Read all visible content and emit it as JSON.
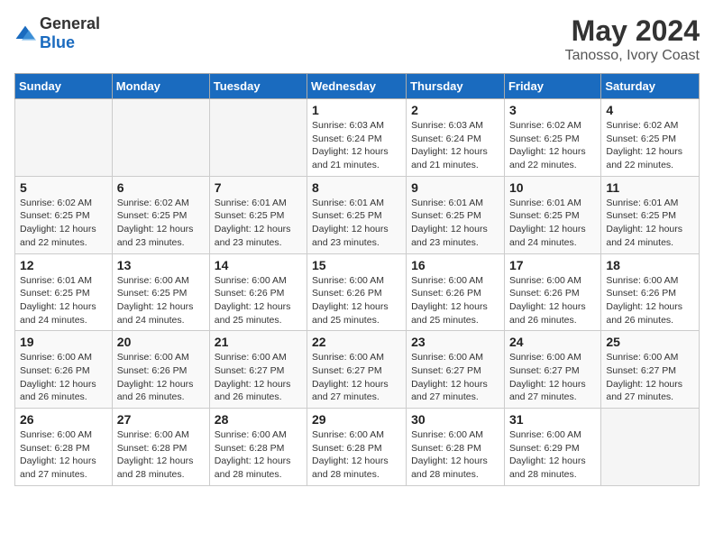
{
  "logo": {
    "general": "General",
    "blue": "Blue"
  },
  "title": "May 2024",
  "subtitle": "Tanosso, Ivory Coast",
  "days_of_week": [
    "Sunday",
    "Monday",
    "Tuesday",
    "Wednesday",
    "Thursday",
    "Friday",
    "Saturday"
  ],
  "weeks": [
    [
      {
        "day": "",
        "info": ""
      },
      {
        "day": "",
        "info": ""
      },
      {
        "day": "",
        "info": ""
      },
      {
        "day": "1",
        "info": "Sunrise: 6:03 AM\nSunset: 6:24 PM\nDaylight: 12 hours and 21 minutes."
      },
      {
        "day": "2",
        "info": "Sunrise: 6:03 AM\nSunset: 6:24 PM\nDaylight: 12 hours and 21 minutes."
      },
      {
        "day": "3",
        "info": "Sunrise: 6:02 AM\nSunset: 6:25 PM\nDaylight: 12 hours and 22 minutes."
      },
      {
        "day": "4",
        "info": "Sunrise: 6:02 AM\nSunset: 6:25 PM\nDaylight: 12 hours and 22 minutes."
      }
    ],
    [
      {
        "day": "5",
        "info": "Sunrise: 6:02 AM\nSunset: 6:25 PM\nDaylight: 12 hours and 22 minutes."
      },
      {
        "day": "6",
        "info": "Sunrise: 6:02 AM\nSunset: 6:25 PM\nDaylight: 12 hours and 23 minutes."
      },
      {
        "day": "7",
        "info": "Sunrise: 6:01 AM\nSunset: 6:25 PM\nDaylight: 12 hours and 23 minutes."
      },
      {
        "day": "8",
        "info": "Sunrise: 6:01 AM\nSunset: 6:25 PM\nDaylight: 12 hours and 23 minutes."
      },
      {
        "day": "9",
        "info": "Sunrise: 6:01 AM\nSunset: 6:25 PM\nDaylight: 12 hours and 23 minutes."
      },
      {
        "day": "10",
        "info": "Sunrise: 6:01 AM\nSunset: 6:25 PM\nDaylight: 12 hours and 24 minutes."
      },
      {
        "day": "11",
        "info": "Sunrise: 6:01 AM\nSunset: 6:25 PM\nDaylight: 12 hours and 24 minutes."
      }
    ],
    [
      {
        "day": "12",
        "info": "Sunrise: 6:01 AM\nSunset: 6:25 PM\nDaylight: 12 hours and 24 minutes."
      },
      {
        "day": "13",
        "info": "Sunrise: 6:00 AM\nSunset: 6:25 PM\nDaylight: 12 hours and 24 minutes."
      },
      {
        "day": "14",
        "info": "Sunrise: 6:00 AM\nSunset: 6:26 PM\nDaylight: 12 hours and 25 minutes."
      },
      {
        "day": "15",
        "info": "Sunrise: 6:00 AM\nSunset: 6:26 PM\nDaylight: 12 hours and 25 minutes."
      },
      {
        "day": "16",
        "info": "Sunrise: 6:00 AM\nSunset: 6:26 PM\nDaylight: 12 hours and 25 minutes."
      },
      {
        "day": "17",
        "info": "Sunrise: 6:00 AM\nSunset: 6:26 PM\nDaylight: 12 hours and 26 minutes."
      },
      {
        "day": "18",
        "info": "Sunrise: 6:00 AM\nSunset: 6:26 PM\nDaylight: 12 hours and 26 minutes."
      }
    ],
    [
      {
        "day": "19",
        "info": "Sunrise: 6:00 AM\nSunset: 6:26 PM\nDaylight: 12 hours and 26 minutes."
      },
      {
        "day": "20",
        "info": "Sunrise: 6:00 AM\nSunset: 6:26 PM\nDaylight: 12 hours and 26 minutes."
      },
      {
        "day": "21",
        "info": "Sunrise: 6:00 AM\nSunset: 6:27 PM\nDaylight: 12 hours and 26 minutes."
      },
      {
        "day": "22",
        "info": "Sunrise: 6:00 AM\nSunset: 6:27 PM\nDaylight: 12 hours and 27 minutes."
      },
      {
        "day": "23",
        "info": "Sunrise: 6:00 AM\nSunset: 6:27 PM\nDaylight: 12 hours and 27 minutes."
      },
      {
        "day": "24",
        "info": "Sunrise: 6:00 AM\nSunset: 6:27 PM\nDaylight: 12 hours and 27 minutes."
      },
      {
        "day": "25",
        "info": "Sunrise: 6:00 AM\nSunset: 6:27 PM\nDaylight: 12 hours and 27 minutes."
      }
    ],
    [
      {
        "day": "26",
        "info": "Sunrise: 6:00 AM\nSunset: 6:28 PM\nDaylight: 12 hours and 27 minutes."
      },
      {
        "day": "27",
        "info": "Sunrise: 6:00 AM\nSunset: 6:28 PM\nDaylight: 12 hours and 28 minutes."
      },
      {
        "day": "28",
        "info": "Sunrise: 6:00 AM\nSunset: 6:28 PM\nDaylight: 12 hours and 28 minutes."
      },
      {
        "day": "29",
        "info": "Sunrise: 6:00 AM\nSunset: 6:28 PM\nDaylight: 12 hours and 28 minutes."
      },
      {
        "day": "30",
        "info": "Sunrise: 6:00 AM\nSunset: 6:28 PM\nDaylight: 12 hours and 28 minutes."
      },
      {
        "day": "31",
        "info": "Sunrise: 6:00 AM\nSunset: 6:29 PM\nDaylight: 12 hours and 28 minutes."
      },
      {
        "day": "",
        "info": ""
      }
    ]
  ]
}
